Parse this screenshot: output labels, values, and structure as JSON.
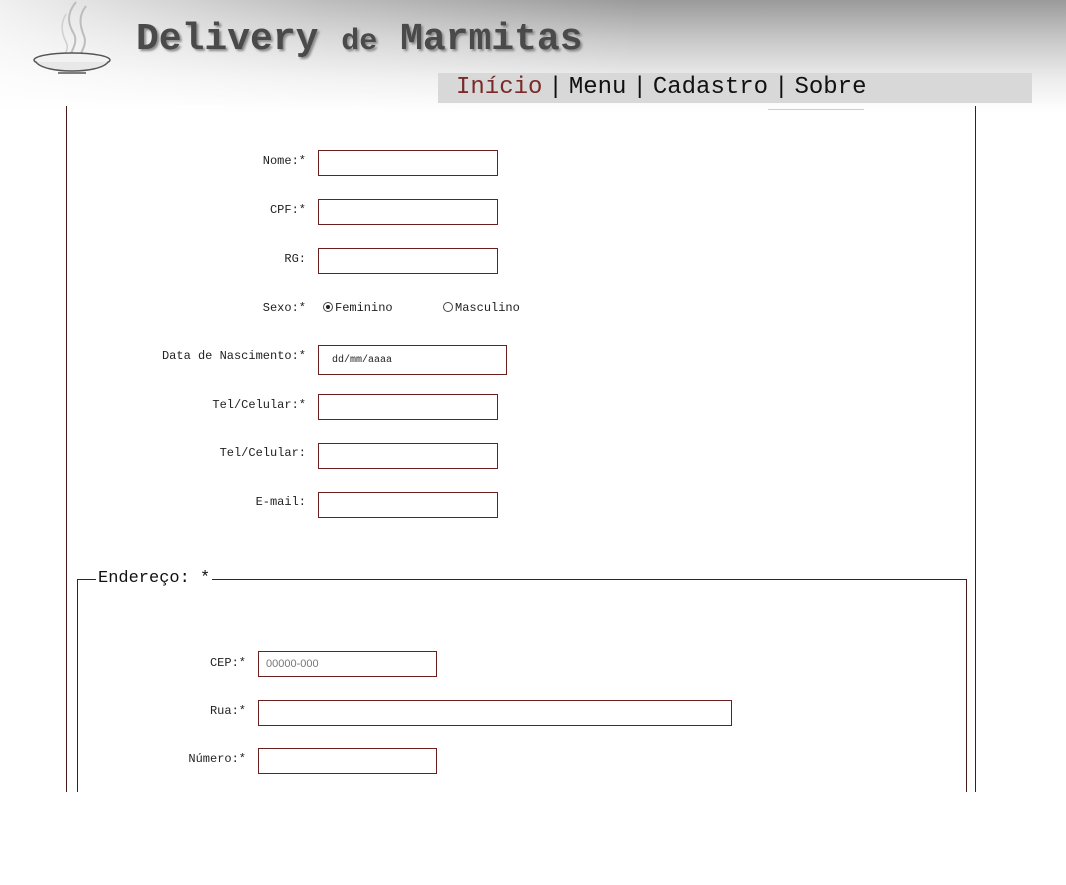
{
  "site": {
    "title_part1": "Delivery",
    "title_part2": "de",
    "title_part3": "Marmitas",
    "logo_icon": "steaming-bowl-icon"
  },
  "nav": {
    "items": [
      "Início",
      "Menu",
      "Cadastro",
      "Sobre"
    ],
    "separator": "|",
    "active": "Início",
    "active_color": "#7a2a2a"
  },
  "form": {
    "nome_label": "Nome:*",
    "cpf_label": "CPF:*",
    "rg_label": "RG:",
    "sexo_label": "Sexo:*",
    "sexo_options": [
      "Feminino",
      "Masculino"
    ],
    "sexo_selected": "Feminino",
    "nascimento_label": "Data de Nascimento:*",
    "nascimento_value": "dd/mm/aaaa",
    "tel1_label": "Tel/Celular:*",
    "tel2_label": "Tel/Celular:",
    "email_label": "E-mail:"
  },
  "address": {
    "legend": "Endereço: *",
    "cep_label": "CEP:*",
    "cep_placeholder": "00000-000",
    "rua_label": "Rua:*",
    "numero_label": "Número:*"
  },
  "colors": {
    "border": "#6b1f1f",
    "frame": "#4a1a1a",
    "nav_bg": "#d8d8d8"
  }
}
